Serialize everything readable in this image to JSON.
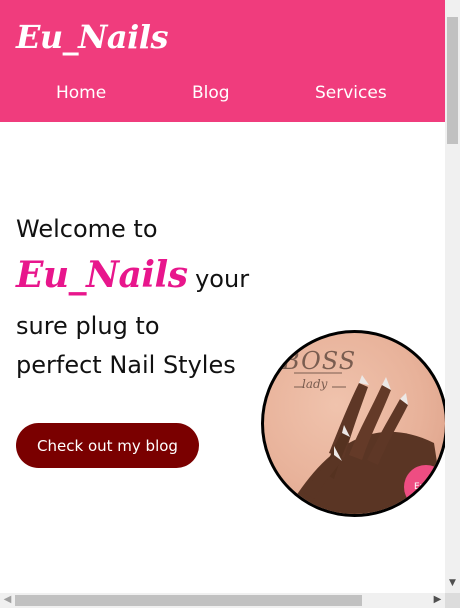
{
  "header": {
    "logo": "Eu_Nails",
    "nav": [
      {
        "label": "Home"
      },
      {
        "label": "Blog"
      },
      {
        "label": "Services"
      }
    ]
  },
  "hero": {
    "line1": "Welcome to",
    "brand": "Eu_Nails",
    "line2_tail": " your",
    "line3": "sure plug to",
    "line4": "perfect Nail Styles",
    "cta_label": "Check out my blog"
  },
  "photo": {
    "print_title": "BOSS",
    "print_subtitle": "lady",
    "badge_text": "Eu"
  },
  "colors": {
    "header_bg": "#f03c7d",
    "brand_pink": "#e8168c",
    "cta_bg": "#7a0000"
  },
  "icons": {
    "scroll_down": "chevron-down-icon",
    "scroll_left": "chevron-left-icon",
    "scroll_right": "chevron-right-icon"
  }
}
